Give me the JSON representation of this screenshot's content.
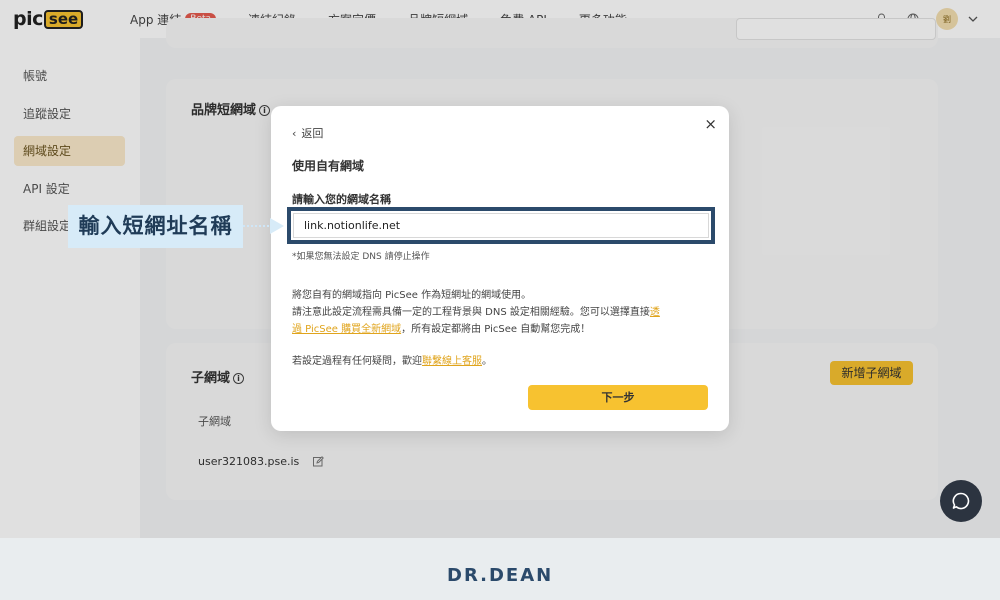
{
  "nav": {
    "logo_pic": "pic",
    "logo_see": "see",
    "items": [
      "App 連結",
      "連結紀錄",
      "方案定價",
      "品牌短網域",
      "免費 API",
      "更多功能"
    ],
    "beta": "Beta",
    "avatar_text": "劉"
  },
  "sidebar": {
    "items": [
      "帳號",
      "追蹤設定",
      "網域設定",
      "API 設定",
      "群組設定"
    ]
  },
  "main": {
    "brand_domain_title": "品牌短網域",
    "subdomain_title": "子網域",
    "add_subdomain": "新增子網域",
    "subdomain_header": "子網域",
    "subdomain_value": "user321083.pse.is"
  },
  "modal": {
    "back": "返回",
    "title": "使用自有網域",
    "label": "請輸入您的網域名稱",
    "input_value": "link.notionlife.net",
    "note": "*如果您無法設定 DNS 請停止操作",
    "para1": "將您自有的網域指向 PicSee 作為短網址的網域使用。",
    "para2a": "請注意此設定流程需具備一定的工程背景與 DNS 設定相關經驗。您可以選擇直接",
    "para2_link1": "透",
    "para2_link2": "過 PicSee 購買全新網域",
    "para2b": "，所有設定都將由 PicSee 自動幫您完成！",
    "para3a": "若設定過程有任何疑問，歡迎",
    "para3_link": "聯繫線上客服",
    "para3b": "。",
    "next": "下一步",
    "close": "×"
  },
  "callout": "輸入短網址名稱",
  "footer": {
    "brand": "DR.DEAN"
  },
  "colors": {
    "accent": "#f7c230",
    "highlight": "#2b4a6b"
  }
}
